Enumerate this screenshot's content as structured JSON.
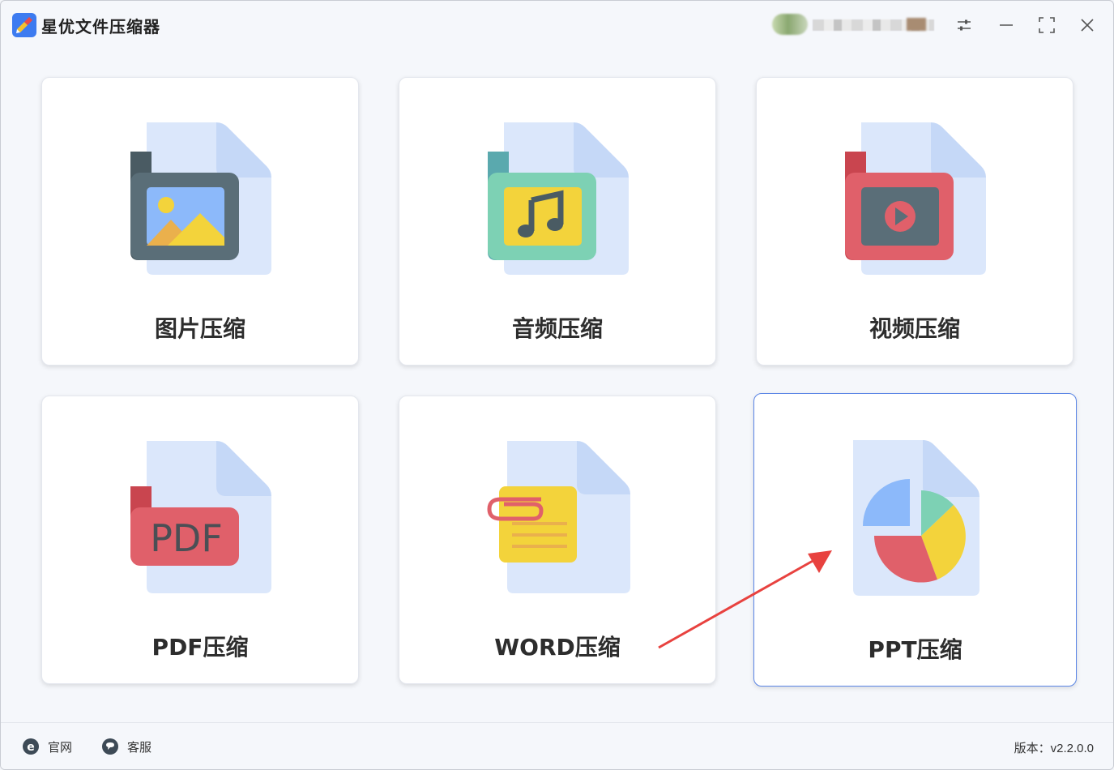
{
  "app": {
    "title": "星优文件压缩器"
  },
  "window_controls": {
    "settings_icon": "sliders-icon",
    "minimize_icon": "minimize-icon",
    "maximize_icon": "maximize-icon",
    "close_icon": "close-icon"
  },
  "cards": [
    {
      "label": "图片压缩",
      "icon": "image-file-icon"
    },
    {
      "label": "音频压缩",
      "icon": "audio-file-icon"
    },
    {
      "label": "视频压缩",
      "icon": "video-file-icon"
    },
    {
      "label": "PDF压缩",
      "icon": "pdf-file-icon"
    },
    {
      "label": "WORD压缩",
      "icon": "word-file-icon"
    },
    {
      "label": "PPT压缩",
      "icon": "ppt-file-icon"
    }
  ],
  "pdf_icon_text": "PDF",
  "footer": {
    "website_label": "官网",
    "support_label": "客服",
    "version_text": "版本：v2.2.0.0"
  },
  "colors": {
    "accent_border": "#5b86e6",
    "arrow": "#e8423f",
    "file_back": "#dbe7fb"
  }
}
